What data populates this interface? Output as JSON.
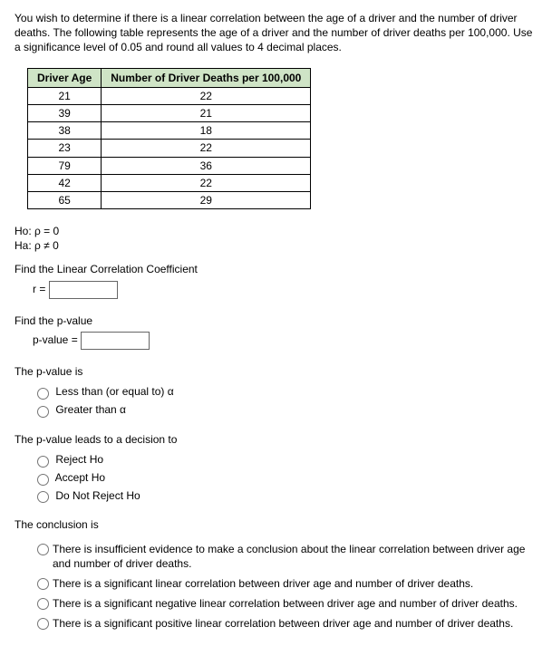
{
  "intro": "You wish to determine if there is a linear correlation between the age of a driver and the number of driver deaths. The following table represents the age of a driver and the number of driver deaths per 100,000. Use a significance level of 0.05 and round all values to 4 decimal places.",
  "table": {
    "header_age": "Driver Age",
    "header_deaths": "Number of Driver Deaths per 100,000",
    "rows": [
      {
        "age": "21",
        "deaths": "22"
      },
      {
        "age": "39",
        "deaths": "21"
      },
      {
        "age": "38",
        "deaths": "18"
      },
      {
        "age": "23",
        "deaths": "22"
      },
      {
        "age": "79",
        "deaths": "36"
      },
      {
        "age": "42",
        "deaths": "22"
      },
      {
        "age": "65",
        "deaths": "29"
      }
    ]
  },
  "hypotheses": {
    "null": "Ho: ρ = 0",
    "alt": "Ha: ρ ≠ 0"
  },
  "corr": {
    "prompt": "Find the Linear Correlation Coefficient",
    "label": "r ="
  },
  "pvalue": {
    "prompt": "Find the p-value",
    "label": "p-value ="
  },
  "pvalue_compare": {
    "prompt": "The p-value is",
    "opt_le": "Less than (or equal to) α",
    "opt_gt": "Greater than α"
  },
  "decision": {
    "prompt": "The p-value leads to a decision to",
    "opt_reject": "Reject Ho",
    "opt_accept": "Accept Ho",
    "opt_dnr": "Do Not Reject Ho"
  },
  "conclusion": {
    "prompt": "The conclusion is",
    "opt1": "There is insufficient evidence to make a conclusion about the linear correlation between driver age and number of driver deaths.",
    "opt2": "There is a significant linear correlation between driver age and number of driver deaths.",
    "opt3": "There is a significant negative linear correlation between driver age and number of driver deaths.",
    "opt4": "There is a significant positive linear correlation between driver age and number of driver deaths."
  },
  "chart_data": {
    "type": "table",
    "title": "Driver Age vs Number of Driver Deaths per 100,000",
    "columns": [
      "Driver Age",
      "Number of Driver Deaths per 100,000"
    ],
    "rows": [
      [
        21,
        22
      ],
      [
        39,
        21
      ],
      [
        38,
        18
      ],
      [
        23,
        22
      ],
      [
        79,
        36
      ],
      [
        42,
        22
      ],
      [
        65,
        29
      ]
    ]
  }
}
